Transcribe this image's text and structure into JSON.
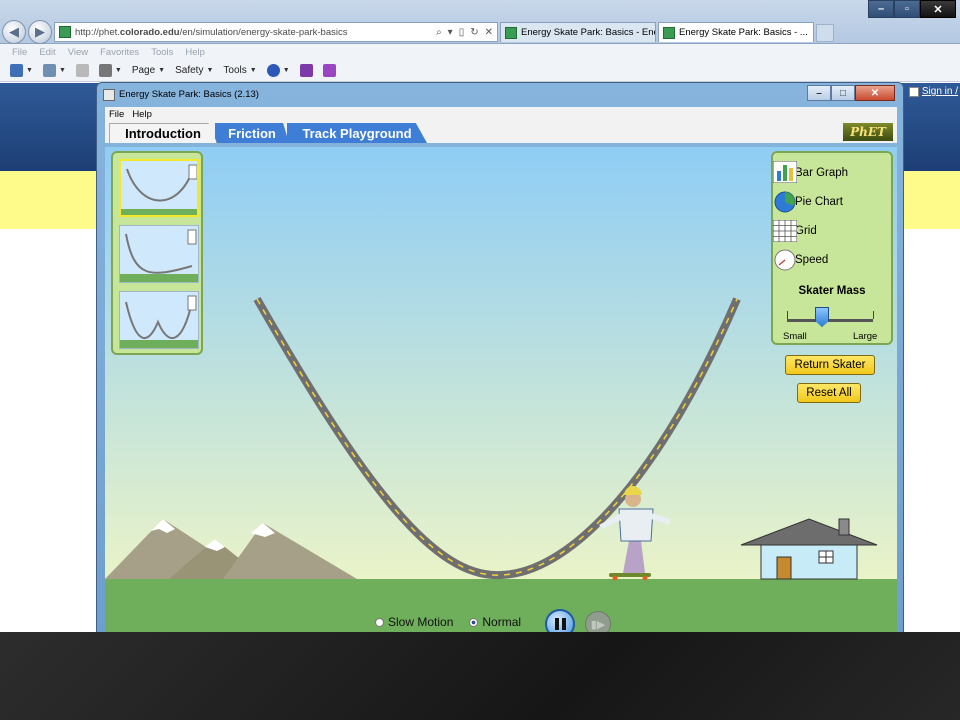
{
  "browser": {
    "url_prefix": "http://phet.",
    "url_domain": "colorado.edu",
    "url_path": "/en/simulation/energy-skate-park-basics",
    "tabs": [
      {
        "label": "Energy Skate Park: Basics - Ene..."
      },
      {
        "label": "Energy Skate Park: Basics - ..."
      }
    ],
    "menu": [
      "File",
      "Edit",
      "View",
      "Favorites",
      "Tools",
      "Help"
    ],
    "command_bar": {
      "page": "Page",
      "safety": "Safety",
      "tools": "Tools"
    },
    "sign_in": "Sign in /"
  },
  "app": {
    "title": "Energy Skate Park: Basics (2.13)",
    "menu": [
      "File",
      "Help"
    ],
    "tabs": [
      "Introduction",
      "Friction",
      "Track Playground"
    ],
    "active_tab": "Introduction",
    "logo": "PhET"
  },
  "controls": {
    "checkboxes": [
      {
        "label": "Bar Graph",
        "checked": false,
        "icon": "bar-graph-icon"
      },
      {
        "label": "Pie Chart",
        "checked": false,
        "icon": "pie-chart-icon"
      },
      {
        "label": "Grid",
        "checked": false,
        "icon": "grid-icon"
      },
      {
        "label": "Speed",
        "checked": false,
        "icon": "speedometer-icon"
      }
    ],
    "mass_title": "Skater Mass",
    "mass_min_label": "Small",
    "mass_max_label": "Large",
    "mass_level": 0.4,
    "return_skater": "Return Skater",
    "reset_all": "Reset All"
  },
  "playback": {
    "slow_motion": "Slow Motion",
    "normal": "Normal",
    "selected": "Normal"
  },
  "colors": {
    "sky": "#a8d8f6",
    "ground": "#6fae5a",
    "panel": "#c8e69a",
    "tab_blue": "#3f7ed6",
    "button_yellow": "#f1c81c"
  }
}
